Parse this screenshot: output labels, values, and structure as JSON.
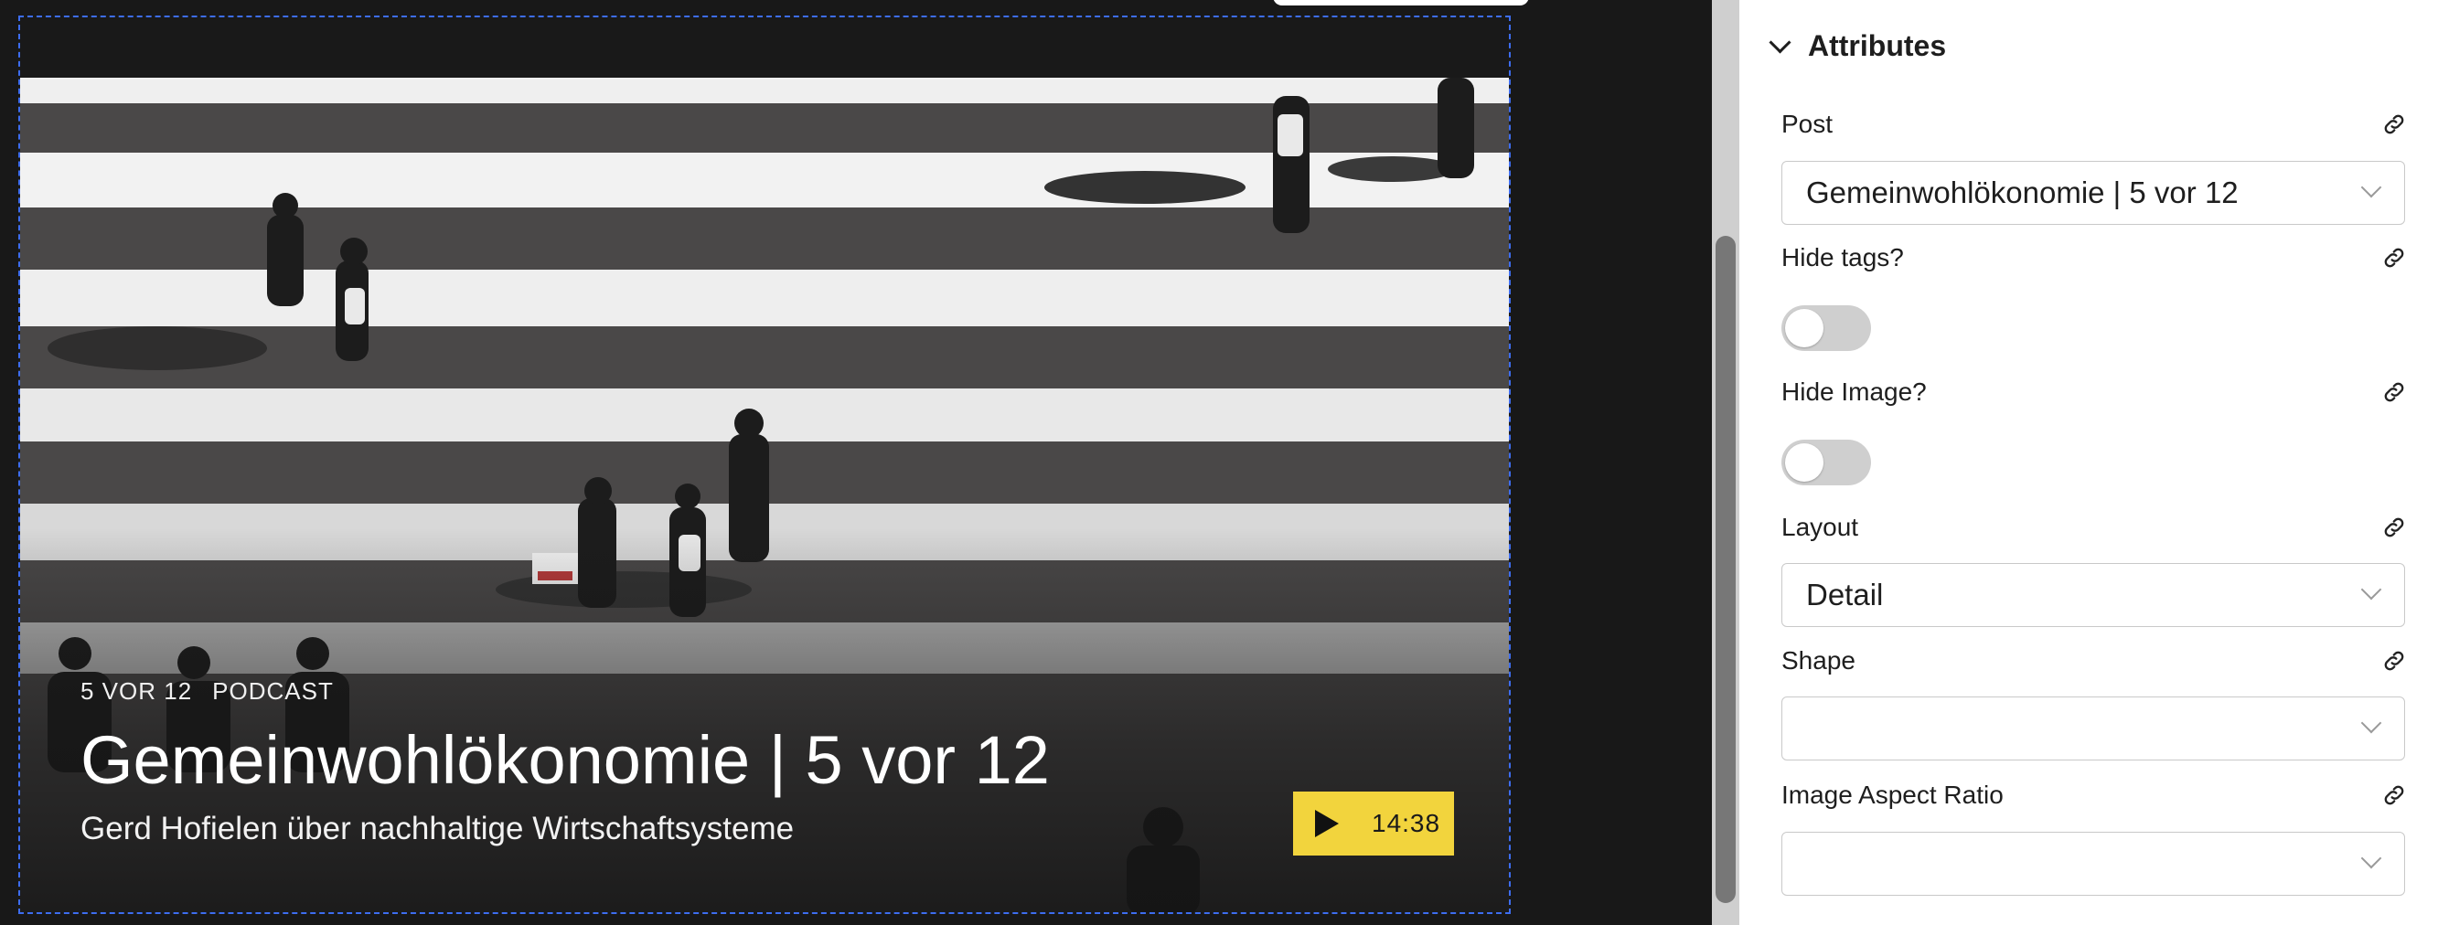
{
  "preview": {
    "tags": [
      "5 VOR 12",
      "PODCAST"
    ],
    "title": "Gemeinwohlökonomie | 5 vor 12",
    "subtitle": "Gerd Hofielen über nachhaltige Wirtschaftsysteme",
    "duration": "14:38"
  },
  "inspector": {
    "section_title": "Attributes",
    "post": {
      "label": "Post",
      "value": "Gemeinwohlökonomie | 5 vor 12"
    },
    "hide_tags": {
      "label": "Hide tags?",
      "enabled": false
    },
    "hide_image": {
      "label": "Hide Image?",
      "enabled": false
    },
    "layout": {
      "label": "Layout",
      "value": "Detail"
    },
    "shape": {
      "label": "Shape",
      "value": ""
    },
    "image_aspect_ratio": {
      "label": "Image Aspect Ratio",
      "value": ""
    }
  },
  "colors": {
    "accent_play": "#f2d43d",
    "selection_border": "#3d6df0",
    "canvas_background": "#181818",
    "toggle_off": "#cfcfcf"
  },
  "icons": [
    "play-icon",
    "chevron-down-icon",
    "link-icon"
  ]
}
